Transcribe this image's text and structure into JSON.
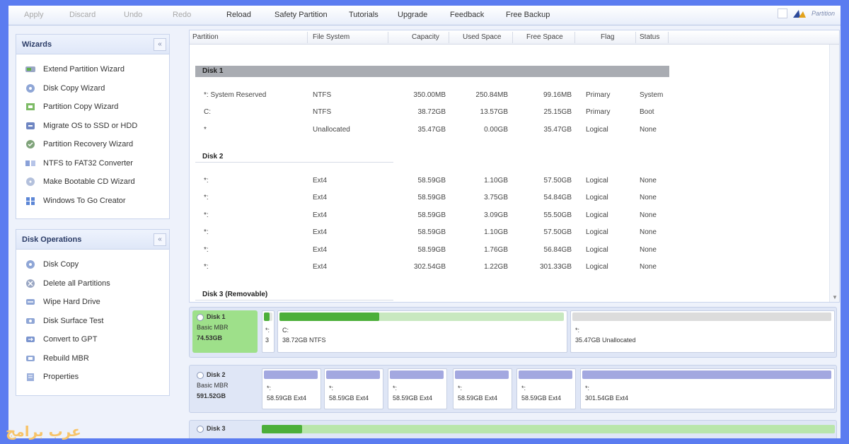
{
  "toolbar": {
    "apply": "Apply",
    "discard": "Discard",
    "undo": "Undo",
    "redo": "Redo",
    "reload": "Reload",
    "safety_partition": "Safety Partition",
    "tutorials": "Tutorials",
    "upgrade": "Upgrade",
    "feedback": "Feedback",
    "free_backup": "Free Backup",
    "logo_text": "Partition"
  },
  "wizards": {
    "title": "Wizards",
    "collapse": "«",
    "items": [
      {
        "label": "Extend Partition Wizard",
        "icon": "extend-partition-icon"
      },
      {
        "label": "Disk Copy Wizard",
        "icon": "disk-copy-icon"
      },
      {
        "label": "Partition Copy Wizard",
        "icon": "partition-copy-icon"
      },
      {
        "label": "Migrate OS to SSD or HDD",
        "icon": "migrate-os-icon"
      },
      {
        "label": "Partition Recovery Wizard",
        "icon": "partition-recovery-icon"
      },
      {
        "label": "NTFS to FAT32 Converter",
        "icon": "ntfs-fat32-icon"
      },
      {
        "label": "Make Bootable CD Wizard",
        "icon": "bootable-cd-icon"
      },
      {
        "label": "Windows To Go Creator",
        "icon": "windows-to-go-icon"
      }
    ]
  },
  "disk_operations": {
    "title": "Disk Operations",
    "collapse": "«",
    "items": [
      {
        "label": "Disk Copy",
        "icon": "disk-copy-icon"
      },
      {
        "label": "Delete all Partitions",
        "icon": "delete-partitions-icon"
      },
      {
        "label": "Wipe Hard Drive",
        "icon": "wipe-drive-icon"
      },
      {
        "label": "Disk Surface Test",
        "icon": "surface-test-icon"
      },
      {
        "label": "Convert to GPT",
        "icon": "convert-gpt-icon"
      },
      {
        "label": "Rebuild MBR",
        "icon": "rebuild-mbr-icon"
      },
      {
        "label": "Properties",
        "icon": "properties-icon"
      }
    ]
  },
  "columns": {
    "partition": "Partition",
    "file_system": "File System",
    "capacity": "Capacity",
    "used_space": "Used Space",
    "free_space": "Free Space",
    "flag": "Flag",
    "status": "Status"
  },
  "disks": [
    {
      "heading": "Disk 1",
      "rows": [
        {
          "partition": "*: System Reserved",
          "fs": "NTFS",
          "capacity": "350.00MB",
          "used": "250.84MB",
          "free": "99.16MB",
          "flag": "Primary",
          "status": "System"
        },
        {
          "partition": "C:",
          "fs": "NTFS",
          "capacity": "38.72GB",
          "used": "13.57GB",
          "free": "25.15GB",
          "flag": "Primary",
          "status": "Boot"
        },
        {
          "partition": "*",
          "fs": "Unallocated",
          "capacity": "35.47GB",
          "used": "0.00GB",
          "free": "35.47GB",
          "flag": "Logical",
          "status": "None"
        }
      ]
    },
    {
      "heading": "Disk 2",
      "rows": [
        {
          "partition": "*:",
          "fs": "Ext4",
          "capacity": "58.59GB",
          "used": "1.10GB",
          "free": "57.50GB",
          "flag": "Logical",
          "status": "None"
        },
        {
          "partition": "*:",
          "fs": "Ext4",
          "capacity": "58.59GB",
          "used": "3.75GB",
          "free": "54.84GB",
          "flag": "Logical",
          "status": "None"
        },
        {
          "partition": "*:",
          "fs": "Ext4",
          "capacity": "58.59GB",
          "used": "3.09GB",
          "free": "55.50GB",
          "flag": "Logical",
          "status": "None"
        },
        {
          "partition": "*:",
          "fs": "Ext4",
          "capacity": "58.59GB",
          "used": "1.10GB",
          "free": "57.50GB",
          "flag": "Logical",
          "status": "None"
        },
        {
          "partition": "*:",
          "fs": "Ext4",
          "capacity": "58.59GB",
          "used": "1.76GB",
          "free": "56.84GB",
          "flag": "Logical",
          "status": "None"
        },
        {
          "partition": "*:",
          "fs": "Ext4",
          "capacity": "302.54GB",
          "used": "1.22GB",
          "free": "301.33GB",
          "flag": "Logical",
          "status": "None"
        }
      ]
    },
    {
      "heading": "Disk 3 (Removable)",
      "rows": []
    }
  ],
  "disk_map": {
    "disk1": {
      "name": "Disk 1",
      "type": "Basic MBR",
      "size": "74.53GB",
      "partitions": [
        {
          "top": "*:",
          "bottom": "3",
          "used_fraction": 0.7
        },
        {
          "top": "C:",
          "bottom": "38.72GB NTFS",
          "used_fraction": 0.35
        },
        {
          "top": "*:",
          "bottom": "35.47GB Unallocated",
          "used_fraction": 0.0
        }
      ]
    },
    "disk2": {
      "name": "Disk 2",
      "type": "Basic MBR",
      "size": "591.52GB",
      "partitions": [
        {
          "top": "*:",
          "bottom": "58.59GB Ext4"
        },
        {
          "top": "*:",
          "bottom": "58.59GB Ext4"
        },
        {
          "top": "*:",
          "bottom": "58.59GB Ext4"
        },
        {
          "top": "*:",
          "bottom": "58.59GB Ext4"
        },
        {
          "top": "*:",
          "bottom": "58.59GB Ext4"
        },
        {
          "top": "*:",
          "bottom": "301.54GB Ext4"
        }
      ]
    },
    "disk3": {
      "name": "Disk 3",
      "used_fraction": 0.07
    }
  },
  "watermark": "عرب برامج",
  "colors": {
    "background": "#5b7cf0",
    "selected_disk": "#9ee08a",
    "used_bar": "#4caf3a",
    "unallocated_bar": "#d8d8d8",
    "ext4_bar": "#a3a8e0"
  }
}
